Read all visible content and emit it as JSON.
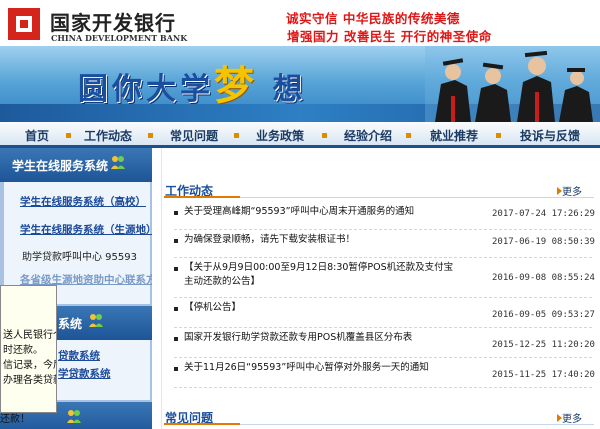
{
  "header": {
    "bank_name_cn": "国家开发银行",
    "bank_name_en": "CHINA DEVELOPMENT BANK",
    "slogan_line1": "诚实守信  中华民族的传统美德",
    "slogan_line2": "增强国力 改善民生  开行的神圣使命",
    "banner_title_part1": "圆你大学",
    "banner_title_dream": "梦",
    "banner_title_part2": "想"
  },
  "nav": {
    "items": [
      "首页",
      "工作动态",
      "常见问题",
      "业务政策",
      "经验介绍",
      "就业推荐",
      "投诉与反馈"
    ]
  },
  "sidebar": {
    "section1_title": "学生在线服务系统",
    "links": [
      "学生在线服务系统（高校）",
      "学生在线服务系统（生源地）"
    ],
    "hotline": "助学贷款呼叫中心   95593",
    "partial_link": "各省级生源地资助中心联系方式",
    "section2_title": "系统",
    "section2_links": [
      "贷款系统",
      "学贷款系统"
    ]
  },
  "popup": {
    "lines": [
      "送人民银行个",
      "时还款。",
      "信记录，今后",
      "办理各类贷款时"
    ],
    "footer": "还款！"
  },
  "main": {
    "section1_title": "工作动态",
    "section2_title": "常见问题",
    "more_label": "更多",
    "news": [
      {
        "title": "关于受理高峰期“95593”呼叫中心周末开通服务的通知",
        "date": "2017-07-24 17:26:29"
      },
      {
        "title": "为确保登录顺畅，请先下载安装根证书！",
        "date": "2017-06-19 08:50:39"
      },
      {
        "title": "【关于从9月9日00:00至9月12日8:30暂停POS机还款及支付宝主动还款的公告】",
        "date": "2016-09-08 08:55:24"
      },
      {
        "title": "【停机公告】",
        "date": "2016-09-05 09:53:27"
      },
      {
        "title": "国家开发银行助学贷款还款专用POS机覆盖县区分布表",
        "date": "2015-12-25 11:20:20"
      },
      {
        "title": "关于11月26日“95593”呼叫中心暂停对外服务一天的通知",
        "date": "2015-11-25 17:40:20"
      }
    ]
  },
  "colors": {
    "brand_red": "#d4241b",
    "slogan_red": "#e01616",
    "nav_text": "#1b3b64",
    "sidebar_bg": "#a7c2e3",
    "link_blue": "#1c4a9a",
    "accent_orange": "#e07b00"
  },
  "icons": {
    "logo": "cdb-logo-icon",
    "people": "people-icon",
    "more_arrow": "arrow-right-icon"
  }
}
